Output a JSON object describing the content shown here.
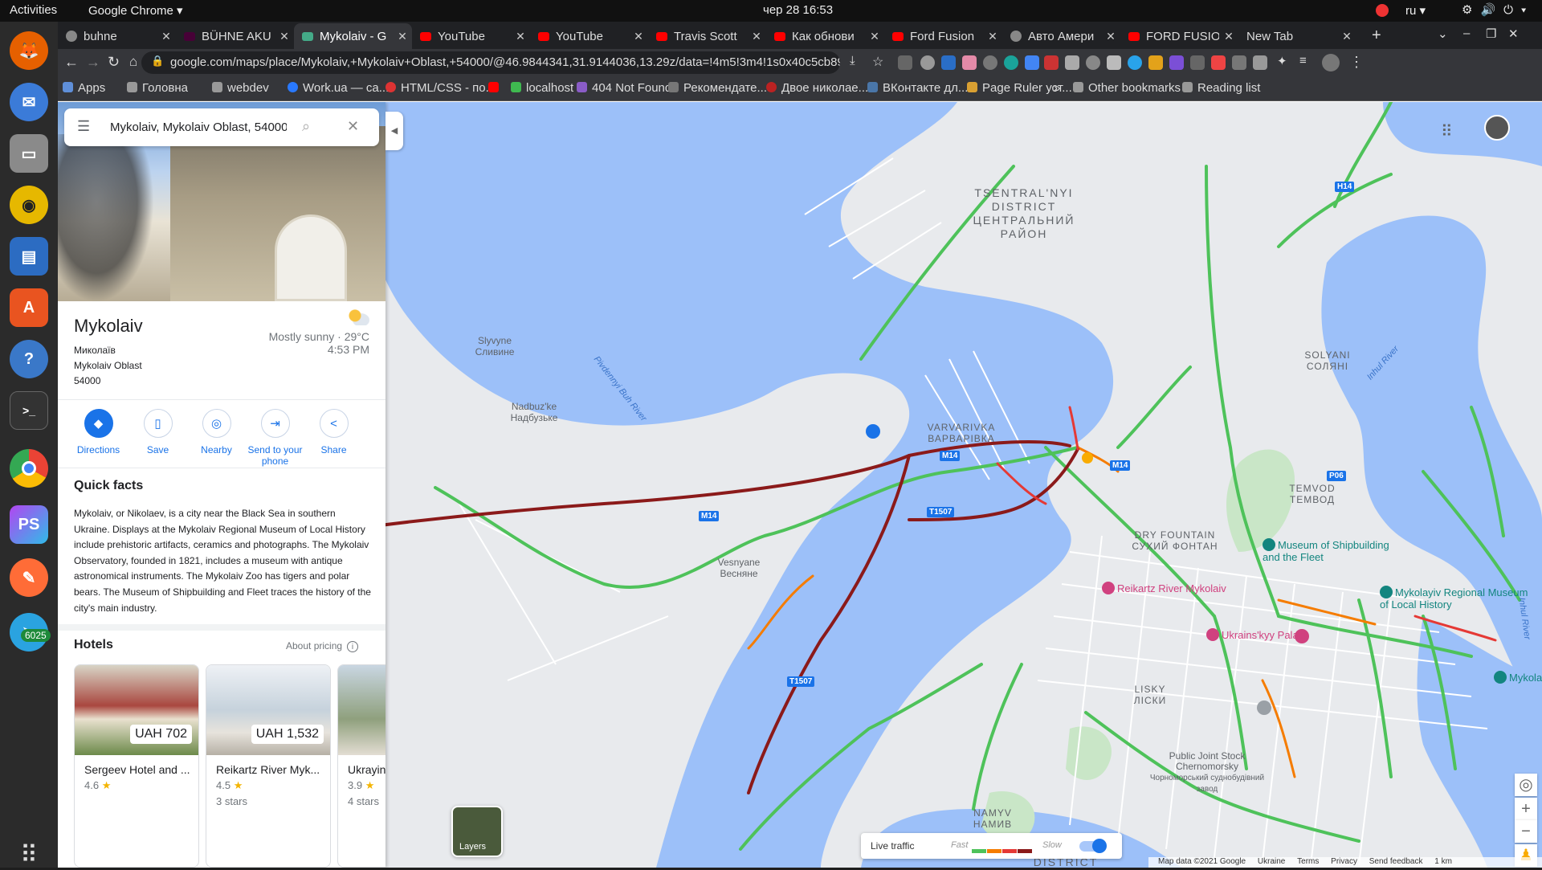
{
  "os": {
    "activities": "Activities",
    "app_name": "Google Chrome ▾",
    "clock": "чер 28  16:53",
    "lang": "ru ▾",
    "dock_badge": "6025"
  },
  "tabs": [
    {
      "title": "buhne"
    },
    {
      "title": "BÜHNE AKU"
    },
    {
      "title": "Mykolaiv - G",
      "active": true
    },
    {
      "title": "YouTube"
    },
    {
      "title": "YouTube"
    },
    {
      "title": "Travis Scott"
    },
    {
      "title": "Как обнови"
    },
    {
      "title": "Ford Fusion"
    },
    {
      "title": "Авто Амери"
    },
    {
      "title": "FORD FUSIO"
    },
    {
      "title": "New Tab"
    }
  ],
  "toolbar": {
    "url": "google.com/maps/place/Mykolaiv,+Mykolaiv+Oblast,+54000/@46.9844341,31.9144036,13.29z/data=!4m5!3m4!1s0x40c5cb89fb7213d5:0x970..."
  },
  "bookmarks": [
    {
      "label": "Apps"
    },
    {
      "label": "Головна"
    },
    {
      "label": "webdev"
    },
    {
      "label": "Work.ua — са..."
    },
    {
      "label": "HTML/CSS - по..."
    },
    {
      "label": ""
    },
    {
      "label": "localhost"
    },
    {
      "label": "404 Not Found"
    },
    {
      "label": "Рекомендате..."
    },
    {
      "label": "Двое николае..."
    },
    {
      "label": "ВКонтакте дл..."
    },
    {
      "label": "Page Ruler уст..."
    }
  ],
  "bookmarks_right": {
    "overflow": "»",
    "other": "Other bookmarks",
    "reading": "Reading list"
  },
  "search": {
    "query": "Mykolaiv, Mykolaiv Oblast, 54000"
  },
  "place": {
    "name": "Mykolaiv",
    "native": "Миколаїв",
    "region": "Mykolaiv Oblast",
    "zip": "54000",
    "weather": "Mostly sunny · 29°C",
    "time": "4:53 PM"
  },
  "actions": [
    {
      "label": "Directions",
      "icon": "directions-icon",
      "glyph": "◆"
    },
    {
      "label": "Save",
      "icon": "bookmark-icon",
      "glyph": "▯"
    },
    {
      "label": "Nearby",
      "icon": "nearby-icon",
      "glyph": "◎"
    },
    {
      "label": "Send to your phone",
      "icon": "phone-icon",
      "glyph": "⇥"
    },
    {
      "label": "Share",
      "icon": "share-icon",
      "glyph": "<"
    }
  ],
  "quick_facts": {
    "title": "Quick facts",
    "text": "Mykolaiv, or Nikolaev, is a city near the Black Sea in southern Ukraine. Displays at the Mykolaiv Regional Museum of Local History include prehistoric artifacts, ceramics and photographs. The Mykolaiv Observatory, founded in 1821, includes a museum with antique astronomical instruments. The Mykolaiv Zoo has tigers and polar bears. The Museum of Shipbuilding and Fleet traces the history of the city's main industry."
  },
  "hotels": {
    "title": "Hotels",
    "about": "About pricing",
    "items": [
      {
        "name": "Sergeev Hotel and ...",
        "price": "UAH 702",
        "rating": "4.6",
        "stars": ""
      },
      {
        "name": "Reikartz River Myk...",
        "price": "UAH 1,532",
        "rating": "4.5",
        "stars": "3 stars"
      },
      {
        "name": "Ukrayin",
        "price": "",
        "rating": "3.9",
        "stars": "4 stars"
      }
    ]
  },
  "map": {
    "labels": {
      "tsentral": "TSENTRAL'NYI DISTRICT ЦЕНТРАЛЬНИЙ РАЙОН",
      "varvarivka": "VARVARIVKA ВАРВАРІВКА",
      "solyani": "SOLYANI СОЛЯНІ",
      "temvod": "TEMVOD ТЕМВОД",
      "sukhyi": "DRY FOUNTAIN СУХИЙ ФОНТАН",
      "lisky": "LISKY ЛІСКИ",
      "namyv": "NAMYV НАМИВ",
      "slyvyne": "Slyvyne Сливине",
      "nadbuzke": "Nadbuz'ke Надбузьке",
      "vesnyane": "Vesnyane Весняне",
      "chernomorsky": "Public Joint Stock Chernomorsky",
      "chernomorsky_ua": "Чорноморський суднобудівний завод",
      "district_bottom": "DISTRICT",
      "pivdennyi": "Pivdennyi Buh River",
      "inhul": "Inhul River",
      "inhul2": "Inhul River"
    },
    "pois": {
      "shipbuilding": "Museum of Shipbuilding and the Fleet",
      "regional": "Mykolayiv Regional Museum of Local History",
      "reikartz": "Reikartz River Mykolaiv",
      "palats": "Ukrains'kyy Palats",
      "mykolaiv_right": "Mykola"
    },
    "shields": [
      "M14",
      "M14",
      "M14",
      "T1507",
      "T1507",
      "P06",
      "H14"
    ],
    "layers": "Layers",
    "traffic": {
      "label": "Live traffic",
      "fast": "Fast",
      "slow": "Slow"
    },
    "footer": {
      "data": "Map data ©2021 Google",
      "country": "Ukraine",
      "terms": "Terms",
      "privacy": "Privacy",
      "feedback": "Send feedback",
      "scale": "1 km"
    }
  },
  "colors": {
    "water": "#9cc0f9",
    "land": "#e8eaed",
    "park": "#c9e6c7",
    "fast": "#4ec25a",
    "medium": "#f57c00",
    "slow": "#e53935",
    "very_slow": "#8b1a1a",
    "accent": "#1a73e8"
  }
}
